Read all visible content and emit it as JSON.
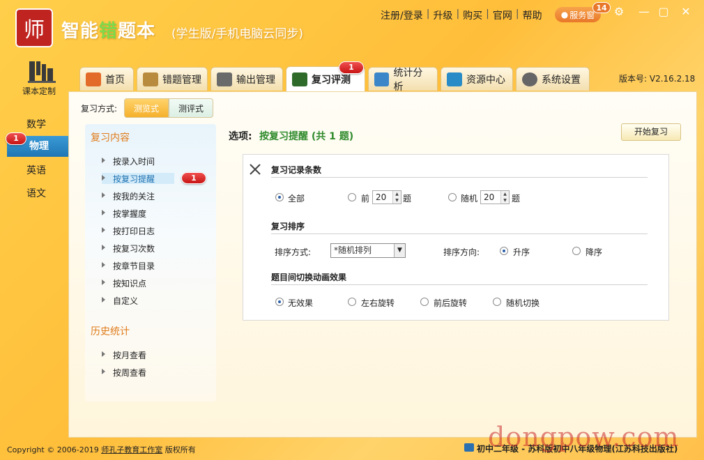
{
  "app": {
    "logo_text": "师",
    "name_pre": "智能",
    "name_hl": "错",
    "name_post": "题本",
    "subtitle": "(学生版/手机电脑云同步)"
  },
  "toplinks": [
    "注册/登录",
    "升级",
    "购买",
    "官网",
    "帮助"
  ],
  "service": {
    "label": "服务窗",
    "badge": "14"
  },
  "window_controls": {
    "settings": "⚙",
    "minimize": "—",
    "maximize": "▢",
    "close": "✕"
  },
  "left_rail": {
    "course_label": "课本定制",
    "subjects": [
      "数学",
      "物理",
      "英语",
      "语文"
    ],
    "active_subject": "物理",
    "active_badge": "1"
  },
  "tabs": [
    {
      "label": "首页",
      "icon": "home-icon",
      "color": "#e36b2a"
    },
    {
      "label": "错题管理",
      "icon": "clipboard-icon",
      "color": "#b98b3e"
    },
    {
      "label": "输出管理",
      "icon": "printer-icon",
      "color": "#6a6a6a"
    },
    {
      "label": "复习评测",
      "icon": "blackboard-icon",
      "color": "#2e6b2b"
    },
    {
      "label": "统计分析",
      "icon": "bar-chart-icon",
      "color": "#3a86c8"
    },
    {
      "label": "资源中心",
      "icon": "resource-icon",
      "color": "#2a8cc6"
    },
    {
      "label": "系统设置",
      "icon": "gear-icon",
      "color": "#666666"
    }
  ],
  "tab_badge": "1",
  "version": "版本号: V2.16.2.18",
  "review_mode": {
    "label": "复习方式:",
    "options": [
      "测览式",
      "测评式"
    ],
    "selected": "测览式"
  },
  "nav": {
    "content_head": "复习内容",
    "content_items": [
      "按录入时间",
      "按复习提醒",
      "按我的关注",
      "按掌握度",
      "按打印日志",
      "按复习次数",
      "按章节目录",
      "按知识点",
      "自定义"
    ],
    "selected": "按复习提醒",
    "selected_badge": "1",
    "history_head": "历史统计",
    "history_items": [
      "按月查看",
      "按周查看"
    ]
  },
  "options": {
    "label": "选项:",
    "value": "按复习提醒 (共 1 题)",
    "start_button": "开始复习"
  },
  "settings": {
    "records": {
      "title": "复习记录条数",
      "all": "全部",
      "first": "前",
      "first_value": "20",
      "first_unit": "题",
      "random": "随机",
      "random_value": "20",
      "random_unit": "题"
    },
    "order": {
      "title": "复习排序",
      "method_label": "排序方式:",
      "method_value": "*随机排列",
      "direction_label": "排序方向:",
      "asc": "升序",
      "desc": "降序"
    },
    "animation": {
      "title": "题目间切换动画效果",
      "options": [
        "无效果",
        "左右旋转",
        "前后旋转",
        "随机切换"
      ]
    }
  },
  "footer": {
    "copy_pre": "Copyright © 2006-2019 ",
    "studio": "师孔子教育工作室",
    "copy_post": " 版权所有",
    "book": "初中二年级 - 苏科版初中八年级物理(江苏科技出版社)"
  },
  "watermark": "dongpow.com"
}
